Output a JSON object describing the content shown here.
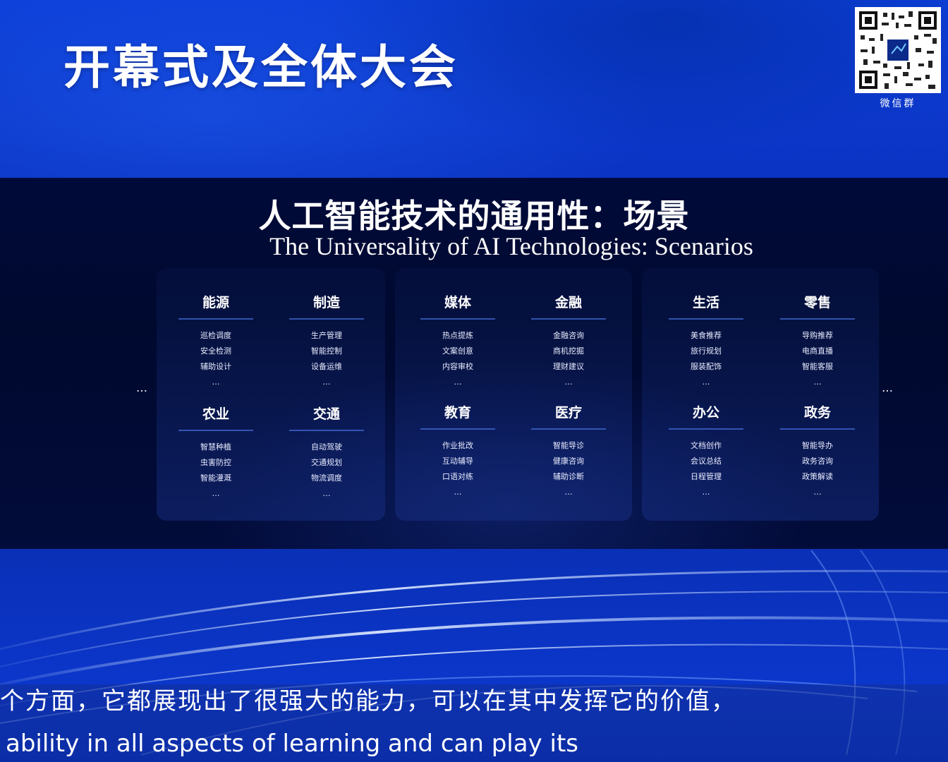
{
  "banner": {
    "title": "开幕式及全体大会"
  },
  "qr": {
    "label": "微信群"
  },
  "slide": {
    "title_cn": "人工智能技术的通用性：场景",
    "title_en": "The Universality of AI Technologies: Scenarios",
    "more_left": "…",
    "more_right": "…",
    "categories": [
      {
        "name": "能源",
        "items": [
          "巡检调度",
          "安全检测",
          "辅助设计",
          "…"
        ]
      },
      {
        "name": "制造",
        "items": [
          "生产管理",
          "智能控制",
          "设备运维",
          "…"
        ]
      },
      {
        "name": "媒体",
        "items": [
          "热点提炼",
          "文案创意",
          "内容审校",
          "…"
        ]
      },
      {
        "name": "金融",
        "items": [
          "金融咨询",
          "商机挖掘",
          "理财建议",
          "…"
        ]
      },
      {
        "name": "生活",
        "items": [
          "美食推荐",
          "旅行规划",
          "服装配饰",
          "…"
        ]
      },
      {
        "name": "零售",
        "items": [
          "导购推荐",
          "电商直播",
          "智能客服",
          "…"
        ]
      },
      {
        "name": "农业",
        "items": [
          "智慧种植",
          "虫害防控",
          "智能灌溉",
          "…"
        ]
      },
      {
        "name": "交通",
        "items": [
          "自动驾驶",
          "交通规划",
          "物流调度",
          "…"
        ]
      },
      {
        "name": "教育",
        "items": [
          "作业批改",
          "互动辅导",
          "口语对练",
          "…"
        ]
      },
      {
        "name": "医疗",
        "items": [
          "智能导诊",
          "健康咨询",
          "辅助诊断",
          "…"
        ]
      },
      {
        "name": "办公",
        "items": [
          "文档创作",
          "会议总结",
          "日程管理",
          "…"
        ]
      },
      {
        "name": "政务",
        "items": [
          "智能导办",
          "政务咨询",
          "政策解读",
          "…"
        ]
      }
    ]
  },
  "subtitles": {
    "cn": "个方面，它都展现出了很强大的能力，可以在其中发挥它的价值，",
    "en": "ability in all aspects of learning and can play its"
  },
  "colors": {
    "banner_blue": "#0d3fd8",
    "slide_navy": "#00092e",
    "divider_blue": "#466edc"
  }
}
